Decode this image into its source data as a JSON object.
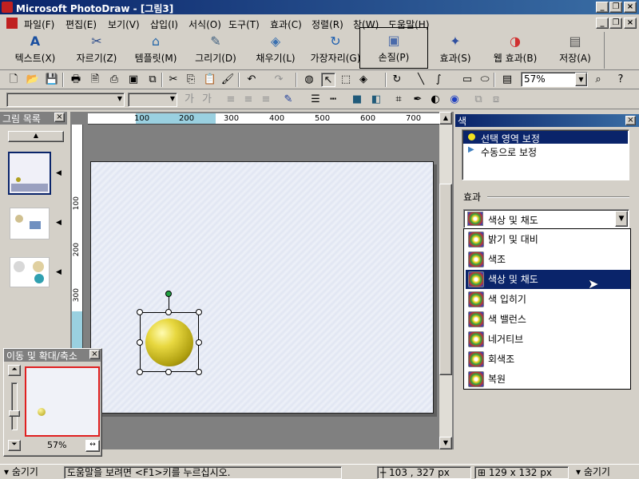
{
  "window": {
    "title": "Microsoft PhotoDraw - [그림3]"
  },
  "menu": [
    "파일(F)",
    "편집(E)",
    "보기(V)",
    "삽입(I)",
    "서식(O)",
    "도구(T)",
    "효과(C)",
    "정렬(R)",
    "창(W)",
    "도움말(H)"
  ],
  "bigtoolbar": [
    "텍스트(X)",
    "자르기(Z)",
    "템플릿(M)",
    "그리기(D)",
    "채우기(L)",
    "가장자리(G)",
    "손질(P)",
    "효과(S)",
    "웹 효과(B)",
    "저장(A)"
  ],
  "toolbar": {
    "zoom": "57%"
  },
  "ruler": {
    "h": [
      "100",
      "200",
      "300",
      "400",
      "500",
      "600",
      "700"
    ],
    "v": [
      "100",
      "200",
      "300"
    ]
  },
  "picturelist": {
    "title": "그림 목록"
  },
  "panzoom": {
    "title": "이동 및 확대/축소",
    "zoom": "57%"
  },
  "colorpanel": {
    "title": "색",
    "modes": [
      "선택 영역 보정",
      "수동으로 보정"
    ],
    "effect_label": "효과",
    "selected": "색상 및 채도",
    "options": [
      "밝기 및 대비",
      "색조",
      "색상 및 채도",
      "색 입히기",
      "색 밸런스",
      "네거티브",
      "회색조",
      "복원"
    ]
  },
  "status": {
    "hide_left": "숨기기",
    "help": "도움말을 보려면 <F1>키를 누르십시오.",
    "position": "103 , 327  px",
    "size": "129 x 132  px",
    "hide_right": "숨기기"
  }
}
